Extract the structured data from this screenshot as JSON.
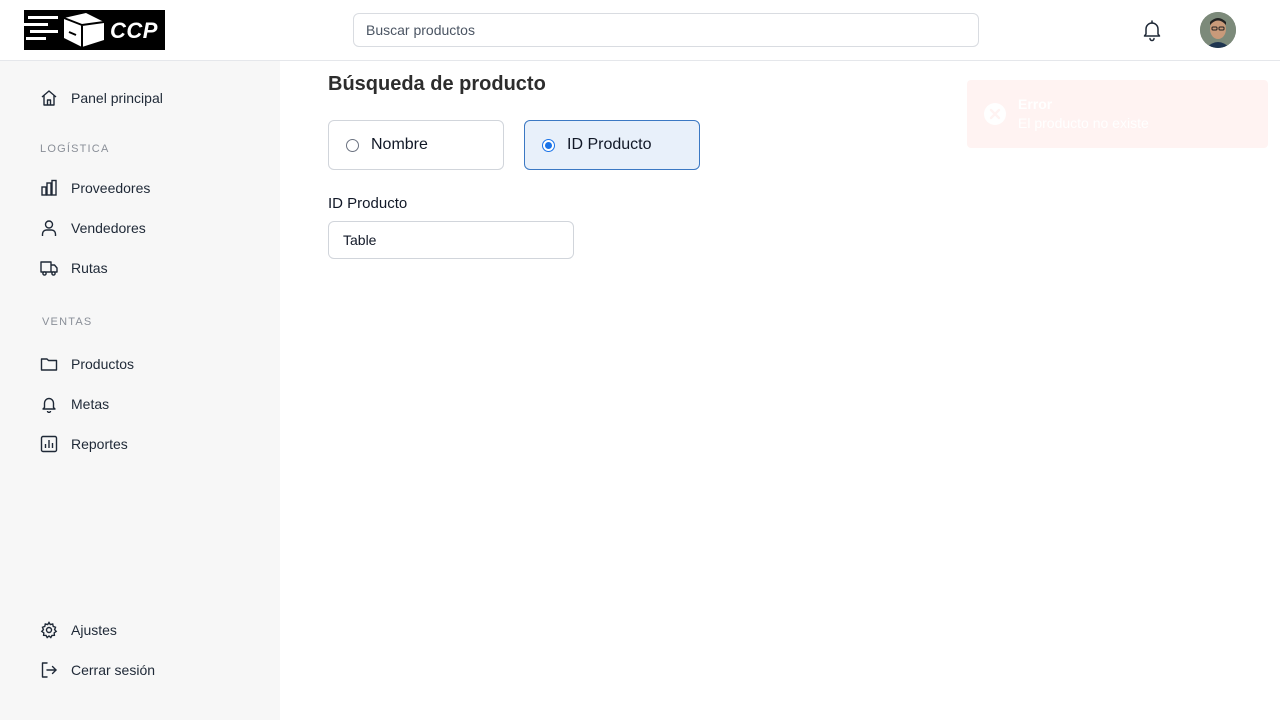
{
  "header": {
    "logo_text": "CCP",
    "search_placeholder": "Buscar productos",
    "notifications_icon": "bell-icon"
  },
  "sidebar": {
    "main_item": {
      "label": "Panel principal",
      "icon": "home-icon"
    },
    "sections": [
      {
        "title": "LOGÍSTICA",
        "items": [
          {
            "label": "Proveedores",
            "icon": "buildings-icon"
          },
          {
            "label": "Vendedores",
            "icon": "user-icon"
          },
          {
            "label": "Rutas",
            "icon": "truck-icon"
          }
        ]
      },
      {
        "title": "VENTAS",
        "items": [
          {
            "label": "Productos",
            "icon": "folder-icon"
          },
          {
            "label": "Metas",
            "icon": "bell-icon"
          },
          {
            "label": "Reportes",
            "icon": "bar-chart-icon"
          }
        ]
      }
    ],
    "footer_items": [
      {
        "label": "Ajustes",
        "icon": "gear-icon"
      },
      {
        "label": "Cerrar sesión",
        "icon": "logout-icon"
      }
    ]
  },
  "main": {
    "title": "Búsqueda de producto",
    "search_options": [
      {
        "label": "Nombre",
        "selected": false
      },
      {
        "label": "ID Producto",
        "selected": true
      }
    ],
    "field_label": "ID Producto",
    "field_value": "Table"
  },
  "toast": {
    "title": "Error",
    "message": "El producto no existe",
    "icon": "error-circle-icon",
    "background": "#fff3f2"
  },
  "colors": {
    "accent": "#1a73e8",
    "selected_border": "#3b78c3",
    "selected_bg": "#e8f0fa",
    "sidebar_bg": "#f7f7f7"
  }
}
